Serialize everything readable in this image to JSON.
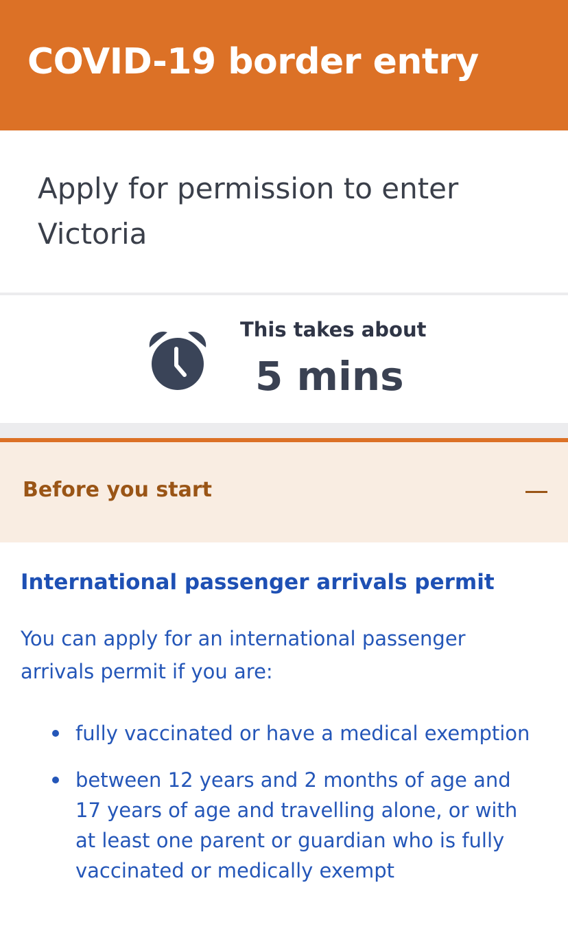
{
  "header": {
    "title": "COVID-19 border entry",
    "background_color": "#dc7126"
  },
  "subtitle": "Apply for permission to enter Victoria",
  "time_estimate": {
    "icon": "alarm-clock-icon",
    "label": "This takes about",
    "value": "5 mins"
  },
  "accordion": {
    "title": "Before you start",
    "toggle_icon": "minus-icon",
    "expanded": true
  },
  "content": {
    "heading": "International passenger arrivals permit",
    "intro": "You can apply for an international passenger arrivals permit if you are:",
    "bullets": [
      "fully vaccinated or have a medical exemption",
      "between 12 years and 2 months of age and 17 years of age and travelling alone, or with at least one parent or guardian who is fully vaccinated or medically exempt"
    ]
  },
  "colors": {
    "accent_orange": "#dc7126",
    "accordion_bg": "#f9ede2",
    "link_blue": "#1e50b4",
    "text_dark": "#3a3f4a"
  }
}
